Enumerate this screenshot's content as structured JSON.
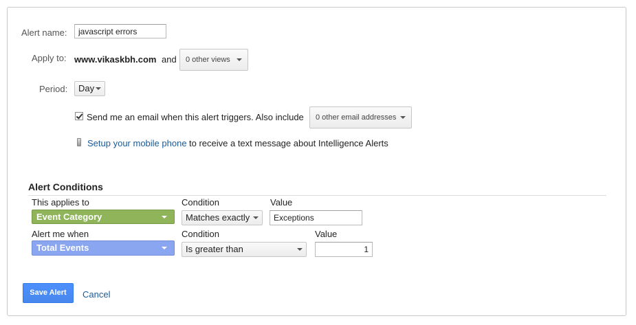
{
  "form": {
    "alert_name_label": "Alert name:",
    "alert_name_value": "javascript errors",
    "apply_to_label": "Apply to:",
    "site": "www.vikaskbh.com",
    "and_text": "and",
    "views_dropdown": "0 other views",
    "period_label": "Period:",
    "period_value": "Day",
    "email_checked": true,
    "email_text": "Send me an email when this alert triggers. Also include",
    "email_dropdown": "0 other email addresses",
    "mobile_link": "Setup your mobile phone",
    "mobile_text": "to receive a text message about Intelligence Alerts"
  },
  "conditions": {
    "title": "Alert Conditions",
    "applies_to_label": "This applies to",
    "condition_label": "Condition",
    "value_label": "Value",
    "applies_dimension": "Event Category",
    "applies_condition": "Matches exactly",
    "applies_value": "Exceptions",
    "alert_when_label": "Alert me when",
    "alert_condition_label": "Condition",
    "alert_value_label": "Value",
    "alert_metric": "Total Events",
    "alert_condition": "Is greater than",
    "alert_value": "1"
  },
  "actions": {
    "save": "Save Alert",
    "cancel": "Cancel"
  },
  "colors": {
    "dimension_chip": "#8fb45a",
    "metric_chip": "#8aa6f0",
    "primary_button": "#4d90fe",
    "link": "#1a5a9a"
  }
}
